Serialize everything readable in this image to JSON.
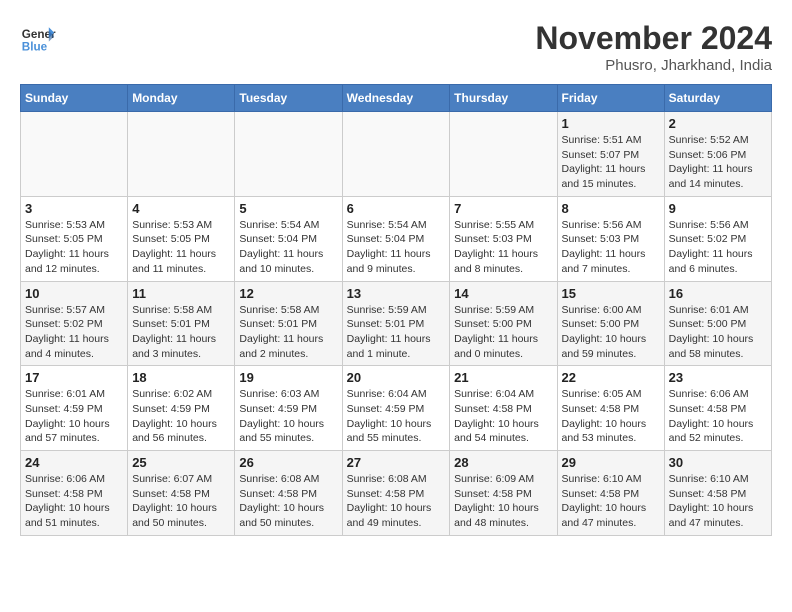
{
  "header": {
    "logo_line1": "General",
    "logo_line2": "Blue",
    "month": "November 2024",
    "location": "Phusro, Jharkhand, India"
  },
  "weekdays": [
    "Sunday",
    "Monday",
    "Tuesday",
    "Wednesday",
    "Thursday",
    "Friday",
    "Saturday"
  ],
  "weeks": [
    [
      {
        "day": "",
        "info": ""
      },
      {
        "day": "",
        "info": ""
      },
      {
        "day": "",
        "info": ""
      },
      {
        "day": "",
        "info": ""
      },
      {
        "day": "",
        "info": ""
      },
      {
        "day": "1",
        "info": "Sunrise: 5:51 AM\nSunset: 5:07 PM\nDaylight: 11 hours\nand 15 minutes."
      },
      {
        "day": "2",
        "info": "Sunrise: 5:52 AM\nSunset: 5:06 PM\nDaylight: 11 hours\nand 14 minutes."
      }
    ],
    [
      {
        "day": "3",
        "info": "Sunrise: 5:53 AM\nSunset: 5:05 PM\nDaylight: 11 hours\nand 12 minutes."
      },
      {
        "day": "4",
        "info": "Sunrise: 5:53 AM\nSunset: 5:05 PM\nDaylight: 11 hours\nand 11 minutes."
      },
      {
        "day": "5",
        "info": "Sunrise: 5:54 AM\nSunset: 5:04 PM\nDaylight: 11 hours\nand 10 minutes."
      },
      {
        "day": "6",
        "info": "Sunrise: 5:54 AM\nSunset: 5:04 PM\nDaylight: 11 hours\nand 9 minutes."
      },
      {
        "day": "7",
        "info": "Sunrise: 5:55 AM\nSunset: 5:03 PM\nDaylight: 11 hours\nand 8 minutes."
      },
      {
        "day": "8",
        "info": "Sunrise: 5:56 AM\nSunset: 5:03 PM\nDaylight: 11 hours\nand 7 minutes."
      },
      {
        "day": "9",
        "info": "Sunrise: 5:56 AM\nSunset: 5:02 PM\nDaylight: 11 hours\nand 6 minutes."
      }
    ],
    [
      {
        "day": "10",
        "info": "Sunrise: 5:57 AM\nSunset: 5:02 PM\nDaylight: 11 hours\nand 4 minutes."
      },
      {
        "day": "11",
        "info": "Sunrise: 5:58 AM\nSunset: 5:01 PM\nDaylight: 11 hours\nand 3 minutes."
      },
      {
        "day": "12",
        "info": "Sunrise: 5:58 AM\nSunset: 5:01 PM\nDaylight: 11 hours\nand 2 minutes."
      },
      {
        "day": "13",
        "info": "Sunrise: 5:59 AM\nSunset: 5:01 PM\nDaylight: 11 hours\nand 1 minute."
      },
      {
        "day": "14",
        "info": "Sunrise: 5:59 AM\nSunset: 5:00 PM\nDaylight: 11 hours\nand 0 minutes."
      },
      {
        "day": "15",
        "info": "Sunrise: 6:00 AM\nSunset: 5:00 PM\nDaylight: 10 hours\nand 59 minutes."
      },
      {
        "day": "16",
        "info": "Sunrise: 6:01 AM\nSunset: 5:00 PM\nDaylight: 10 hours\nand 58 minutes."
      }
    ],
    [
      {
        "day": "17",
        "info": "Sunrise: 6:01 AM\nSunset: 4:59 PM\nDaylight: 10 hours\nand 57 minutes."
      },
      {
        "day": "18",
        "info": "Sunrise: 6:02 AM\nSunset: 4:59 PM\nDaylight: 10 hours\nand 56 minutes."
      },
      {
        "day": "19",
        "info": "Sunrise: 6:03 AM\nSunset: 4:59 PM\nDaylight: 10 hours\nand 55 minutes."
      },
      {
        "day": "20",
        "info": "Sunrise: 6:04 AM\nSunset: 4:59 PM\nDaylight: 10 hours\nand 55 minutes."
      },
      {
        "day": "21",
        "info": "Sunrise: 6:04 AM\nSunset: 4:58 PM\nDaylight: 10 hours\nand 54 minutes."
      },
      {
        "day": "22",
        "info": "Sunrise: 6:05 AM\nSunset: 4:58 PM\nDaylight: 10 hours\nand 53 minutes."
      },
      {
        "day": "23",
        "info": "Sunrise: 6:06 AM\nSunset: 4:58 PM\nDaylight: 10 hours\nand 52 minutes."
      }
    ],
    [
      {
        "day": "24",
        "info": "Sunrise: 6:06 AM\nSunset: 4:58 PM\nDaylight: 10 hours\nand 51 minutes."
      },
      {
        "day": "25",
        "info": "Sunrise: 6:07 AM\nSunset: 4:58 PM\nDaylight: 10 hours\nand 50 minutes."
      },
      {
        "day": "26",
        "info": "Sunrise: 6:08 AM\nSunset: 4:58 PM\nDaylight: 10 hours\nand 50 minutes."
      },
      {
        "day": "27",
        "info": "Sunrise: 6:08 AM\nSunset: 4:58 PM\nDaylight: 10 hours\nand 49 minutes."
      },
      {
        "day": "28",
        "info": "Sunrise: 6:09 AM\nSunset: 4:58 PM\nDaylight: 10 hours\nand 48 minutes."
      },
      {
        "day": "29",
        "info": "Sunrise: 6:10 AM\nSunset: 4:58 PM\nDaylight: 10 hours\nand 47 minutes."
      },
      {
        "day": "30",
        "info": "Sunrise: 6:10 AM\nSunset: 4:58 PM\nDaylight: 10 hours\nand 47 minutes."
      }
    ]
  ]
}
